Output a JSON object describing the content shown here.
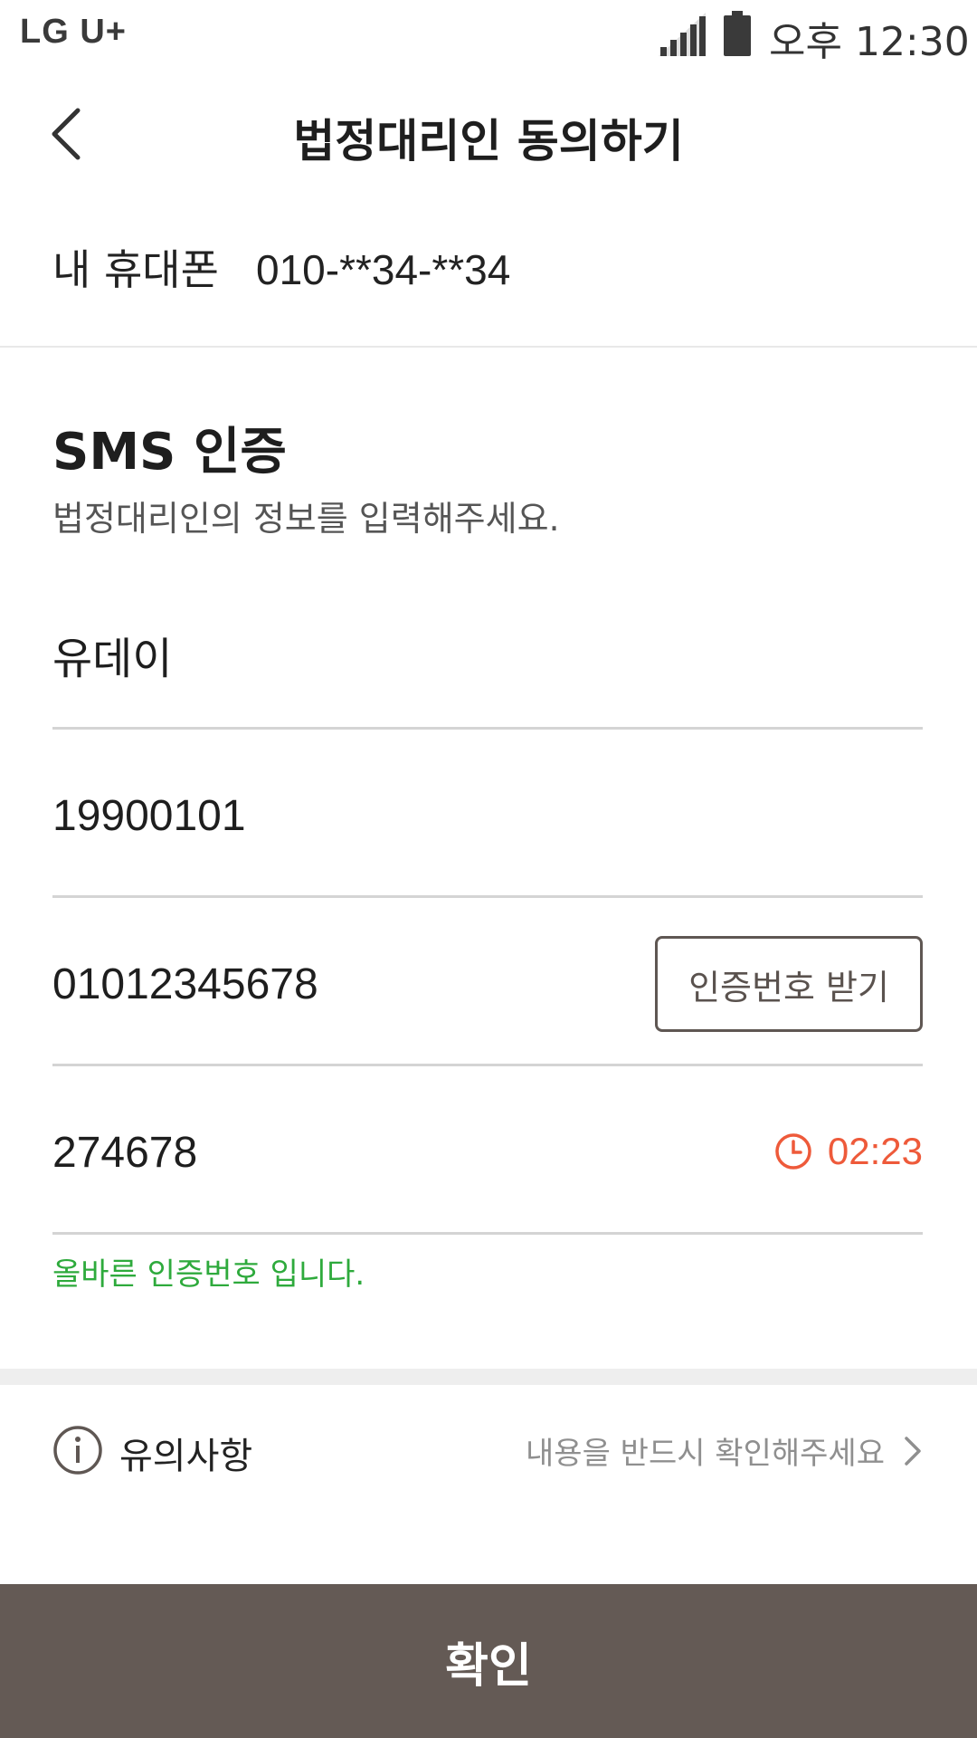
{
  "status_bar": {
    "carrier": "LG U+",
    "time": "오후 12:30",
    "icons": [
      "signal-icon",
      "battery-icon"
    ]
  },
  "header": {
    "back_icon": "chevron-left-icon",
    "title": "법정대리인 동의하기"
  },
  "my_phone": {
    "label": "내 휴대폰",
    "value": "010-**34-**34"
  },
  "sms_section": {
    "title": "SMS 인증",
    "subtitle": "법정대리인의 정보를 입력해주세요."
  },
  "form": {
    "name": "유데이",
    "birthdate": "19900101",
    "phone": "01012345678",
    "request_code_label": "인증번호 받기",
    "code": "274678",
    "timer": "02:23",
    "success_message": "올바른 인증번호 입니다."
  },
  "notice": {
    "icon": "info-icon",
    "title": "유의사항",
    "link_text": "내용을 반드시 확인해주세요"
  },
  "confirm_label": "확인",
  "colors": {
    "accent": "#645a55",
    "timer": "#ee5a3a",
    "success": "#2eaa3c",
    "divider": "#d4d4d4"
  }
}
